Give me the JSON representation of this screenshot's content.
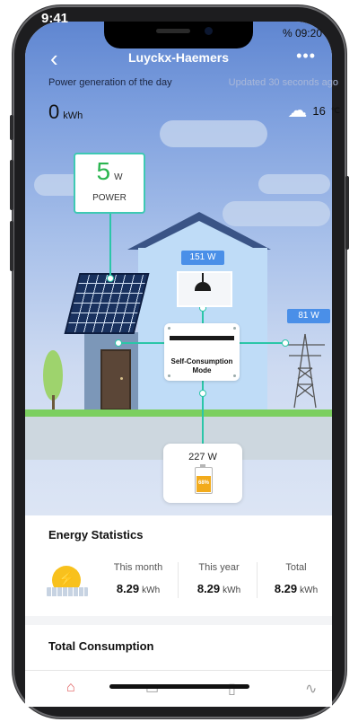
{
  "status_bar": {
    "time": "9:41",
    "right_text": "% 09:20"
  },
  "header": {
    "back_icon": "chevron-left-icon",
    "title": "Luyckx-Haemers",
    "more_icon": "more-icon",
    "more_glyph": "•••"
  },
  "generation": {
    "label": "Power generation of the day",
    "updated": "Updated 30 seconds ago",
    "value": "0",
    "unit": "kWh"
  },
  "weather": {
    "icon": "cloud-rain-icon",
    "temperature": "16",
    "unit": "℃"
  },
  "diagram": {
    "power_value": "5",
    "power_unit": "W",
    "power_label": "POWER",
    "home_load": "151 W",
    "grid_power": "81 W",
    "inverter_mode": "Self-Consumption Mode",
    "battery_power": "227 W",
    "battery_percent": "68%",
    "battery_level": 0.68,
    "colors": {
      "flow_line": "#2bc6a8",
      "power_value": "#2ab54f",
      "badge": "#4a8fe8",
      "battery": "#f2ab1c"
    }
  },
  "energy_statistics": {
    "title": "Energy Statistics",
    "columns": [
      {
        "label": "This month",
        "value": "8.29",
        "unit": "kWh"
      },
      {
        "label": "This year",
        "value": "8.29",
        "unit": "kWh"
      },
      {
        "label": "Total",
        "value": "8.29",
        "unit": "kWh"
      }
    ]
  },
  "total_consumption": {
    "title": "Total Consumption"
  },
  "tabbar": {
    "icons": [
      "home-icon",
      "storage-icon",
      "device-icon",
      "chart-icon"
    ],
    "active_color": "#e05a5a"
  }
}
